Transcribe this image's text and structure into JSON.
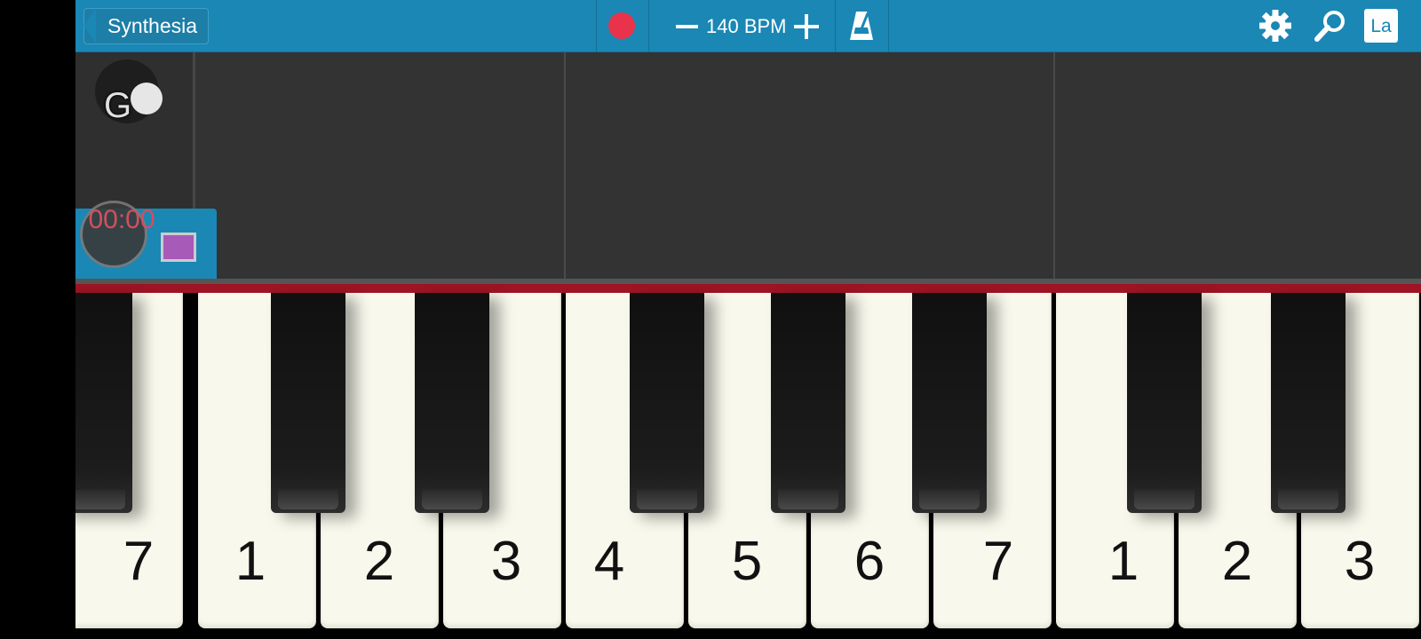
{
  "toolbar": {
    "back_label": "Synthesia",
    "bpm_label": "140 BPM",
    "language_label": "La",
    "icons": [
      "back-arrow-icon",
      "record-icon",
      "minus-icon",
      "plus-icon",
      "metronome-icon",
      "gear-icon",
      "search-icon"
    ],
    "colors": {
      "bar": "#1a87b5",
      "record": "#e8334a"
    }
  },
  "left_panel": {
    "toggle_letter": "G",
    "timer": "00:00",
    "swatch_color": "#a85ab8"
  },
  "keyboard": {
    "white_key_labels": [
      "7",
      "1",
      "2",
      "3",
      "4",
      "5",
      "6",
      "7",
      "1",
      "2",
      "3"
    ]
  }
}
